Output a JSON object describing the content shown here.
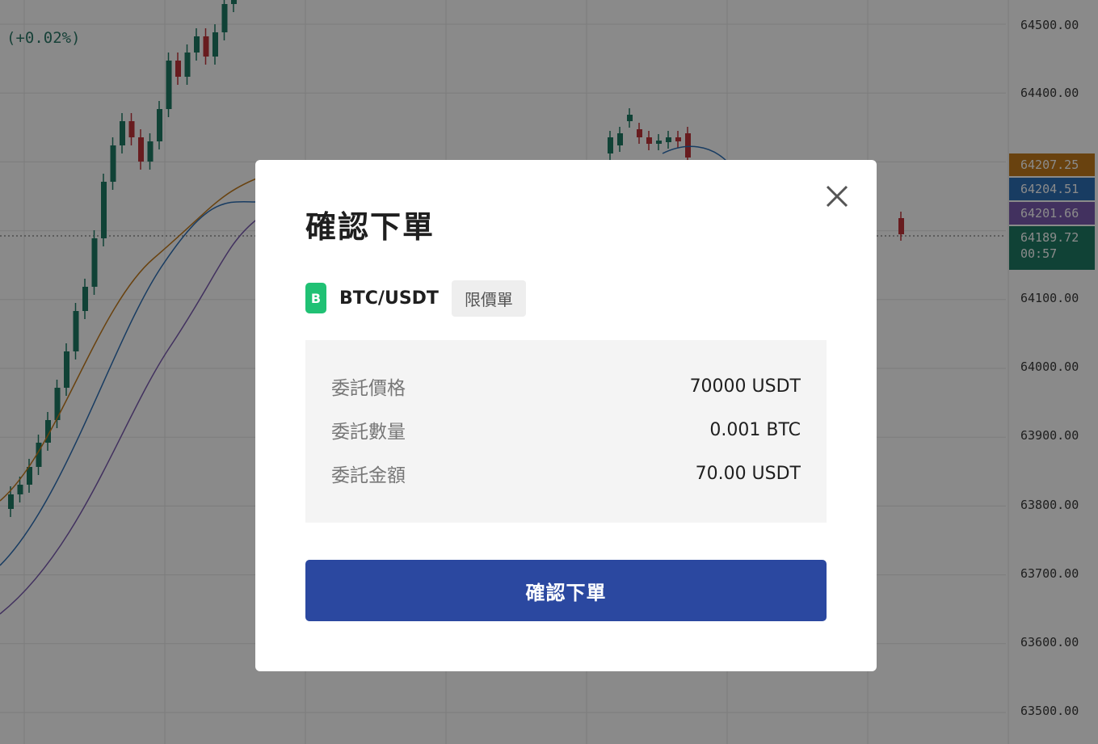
{
  "chart": {
    "change_text": "(+0.02%)",
    "price_axis": [
      "64500.00",
      "64400.00",
      "64100.00",
      "64000.00",
      "63900.00",
      "63800.00",
      "63700.00",
      "63600.00",
      "63500.00"
    ],
    "price_tags": [
      {
        "value": "64207.25",
        "color": "#c27a1c"
      },
      {
        "value": "64204.51",
        "color": "#2e6fb5"
      },
      {
        "value": "64201.66",
        "color": "#7a5bb0"
      }
    ],
    "last_price": {
      "value": "64189.72",
      "timer": "00:57",
      "color": "#1e7a64"
    }
  },
  "modal": {
    "title": "確認下單",
    "side_badge": "B",
    "pair": "BTC/USDT",
    "order_type": "限價單",
    "details": [
      {
        "label": "委託價格",
        "value": "70000 USDT"
      },
      {
        "label": "委託數量",
        "value": "0.001 BTC"
      },
      {
        "label": "委託金額",
        "value": "70.00 USDT"
      }
    ],
    "confirm_label": "確認下單",
    "close_icon": "close-icon"
  },
  "colors": {
    "up": "#1e7a64",
    "down": "#c0343a",
    "accent": "#2b48a0",
    "badge_buy": "#20c174"
  }
}
